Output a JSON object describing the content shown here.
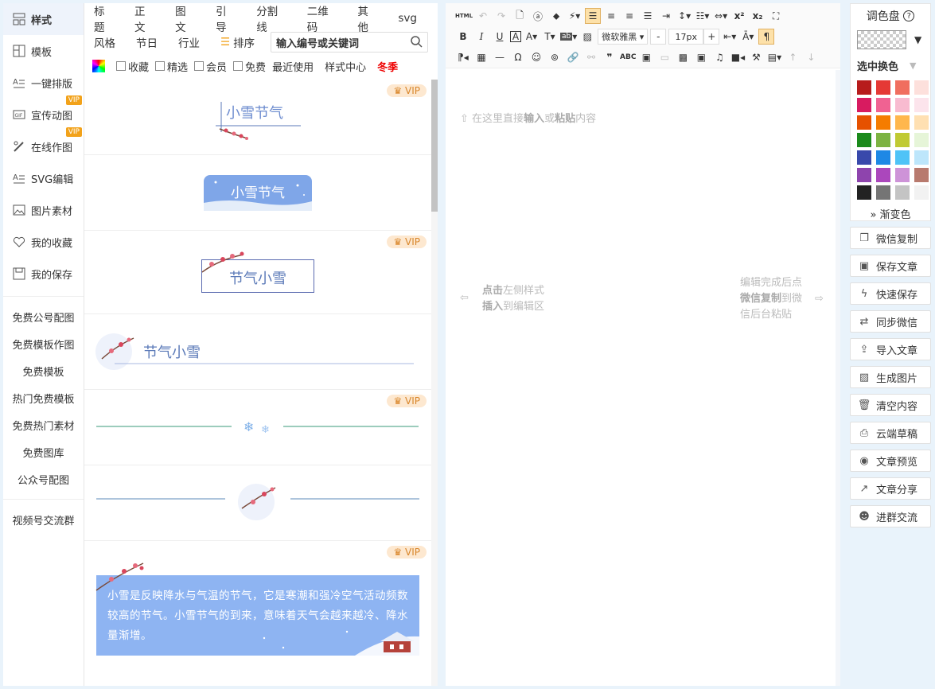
{
  "sidebar": {
    "items": [
      {
        "label": "样式",
        "icon": "layout-icon"
      },
      {
        "label": "模板",
        "icon": "grid-icon"
      },
      {
        "label": "一键排版",
        "icon": "text-format-icon"
      },
      {
        "label": "宣传动图",
        "icon": "gif-icon",
        "badge": "VIP"
      },
      {
        "label": "在线作图",
        "icon": "pen-icon",
        "badge": "VIP"
      },
      {
        "label": "SVG编辑",
        "icon": "svg-edit-icon"
      },
      {
        "label": "图片素材",
        "icon": "image-icon"
      },
      {
        "label": "我的收藏",
        "icon": "heart-icon"
      },
      {
        "label": "我的保存",
        "icon": "save-icon"
      }
    ],
    "links": [
      "免费公号配图",
      "免费模板作图",
      "免费模板",
      "热门免费模板",
      "免费热门素材",
      "免费图库",
      "公众号配图"
    ],
    "extra": "视频号交流群"
  },
  "style_panel": {
    "categories_row1": [
      "标题",
      "正文",
      "图文",
      "引导",
      "分割线",
      "二维码",
      "其他",
      "svg"
    ],
    "categories_row2": [
      "风格",
      "节日",
      "行业"
    ],
    "sort_label": "排序",
    "search_placeholder": "输入编号或关键词",
    "filters": [
      "收藏",
      "精选",
      "会员",
      "免费"
    ],
    "plain_links": [
      "最近使用",
      "样式中心"
    ],
    "season": "冬季",
    "vip_label": "VIP",
    "items": {
      "t1": "小雪节气",
      "t2": "小雪节气",
      "t3": "节气小雪",
      "t4": "节气小雪",
      "t7_body": "小雪是反映降水与气温的节气，它是寒潮和强冷空气活动频数较高的节气。小雪节气的到来，意味着天气会越来越冷、降水量渐增。"
    }
  },
  "editor": {
    "font_name": "微软雅黑",
    "font_size": "17px",
    "minus": "-",
    "plus": "+",
    "html_btn": "HTML",
    "hint_top_pre": "在这里直接",
    "hint_top_b1": "输入",
    "hint_top_mid": "或",
    "hint_top_b2": "粘贴",
    "hint_top_post": "内容",
    "hint_left_b1": "点击",
    "hint_left_t1": "左侧样式",
    "hint_left_b2": "插入",
    "hint_left_t2": "到编辑区",
    "hint_right_l1": "编辑完成后点",
    "hint_right_b": "微信复制",
    "hint_right_t2": "到微",
    "hint_right_l3": "信后台粘贴"
  },
  "palette": {
    "title": "调色盘",
    "selected_label": "选中换色",
    "gradient_label": "渐变色",
    "colors": [
      "#b71c1c",
      "#e53935",
      "#f06e5f",
      "#fde0dc",
      "#d81b60",
      "#f06292",
      "#f8bbd0",
      "#fce4ec",
      "#e65100",
      "#f57c00",
      "#ffb74d",
      "#ffe0b2",
      "#1b8a1b",
      "#7cb342",
      "#c0ca33",
      "#e6f5d8",
      "#3949ab",
      "#1e88e5",
      "#4fc3f7",
      "#bde6fb",
      "#8e44ad",
      "#ab47bc",
      "#ce93d8",
      "#b87a6e",
      "#222222",
      "#757575",
      "#c4c4c4",
      "#f2f2f2"
    ]
  },
  "right_buttons": [
    {
      "label": "微信复制",
      "icon": "copy-icon"
    },
    {
      "label": "保存文章",
      "icon": "save-icon"
    },
    {
      "label": "快速保存",
      "icon": "lightning-icon"
    },
    {
      "label": "同步微信",
      "icon": "sync-icon"
    },
    {
      "label": "导入文章",
      "icon": "import-icon"
    },
    {
      "label": "生成图片",
      "icon": "image-icon"
    },
    {
      "label": "清空内容",
      "icon": "trash-icon"
    },
    {
      "label": "云端草稿",
      "icon": "cloud-draft-icon"
    },
    {
      "label": "文章预览",
      "icon": "eye-icon"
    },
    {
      "label": "文章分享",
      "icon": "share-icon"
    },
    {
      "label": "进群交流",
      "icon": "group-icon"
    }
  ]
}
